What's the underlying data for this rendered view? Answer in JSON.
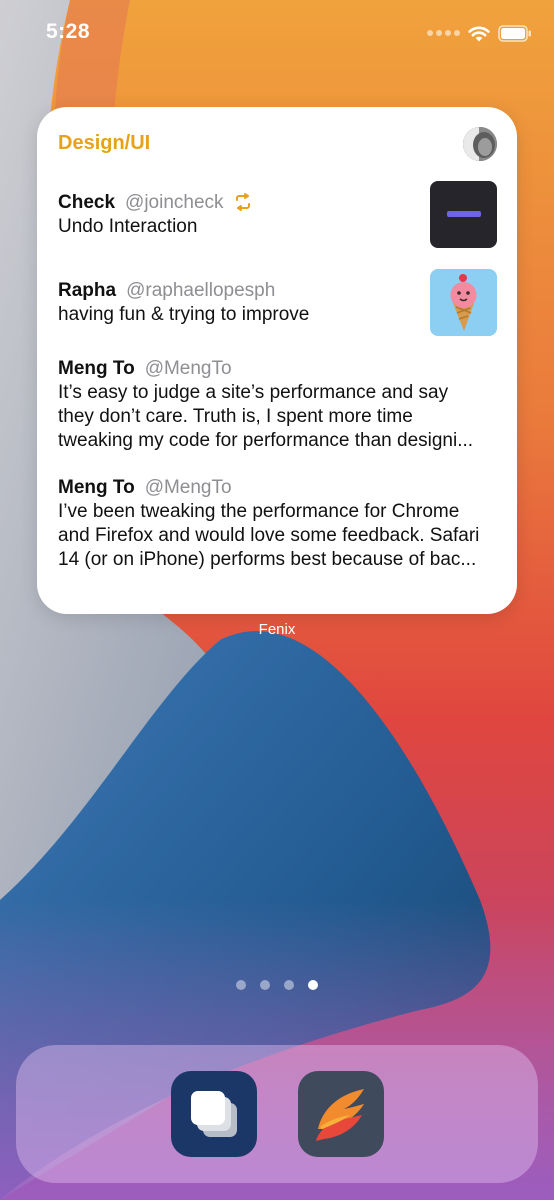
{
  "status_bar": {
    "time": "5:28"
  },
  "widget": {
    "title": "Design/UI",
    "tweets": [
      {
        "name": "Check",
        "handle": "@joincheck",
        "text": "Undo Interaction",
        "retweet": true
      },
      {
        "name": "Rapha",
        "handle": "@raphaellopesph",
        "text": "having fun & trying to improve"
      },
      {
        "name": "Meng To",
        "handle": "@MengTo",
        "lines": [
          "It’s easy to judge a site’s performance and say",
          "they don’t care. Truth is, I spent more time",
          "tweaking my code for performance than designi..."
        ]
      },
      {
        "name": "Meng To",
        "handle": "@MengTo",
        "lines": [
          "I’ve been tweaking the performance for Chrome",
          "and Firefox and would love some feedback. Safari",
          "14 (or on iPhone) performs best because of bac..."
        ]
      }
    ],
    "label": "Fenix"
  },
  "page_dots": {
    "count": 4,
    "active": 4
  },
  "dock": {
    "apps": [
      "stacked-cards-app-icon",
      "fenix-app-icon"
    ]
  },
  "colors": {
    "accent": "#e8a21a",
    "handle": "#8e8e93"
  }
}
